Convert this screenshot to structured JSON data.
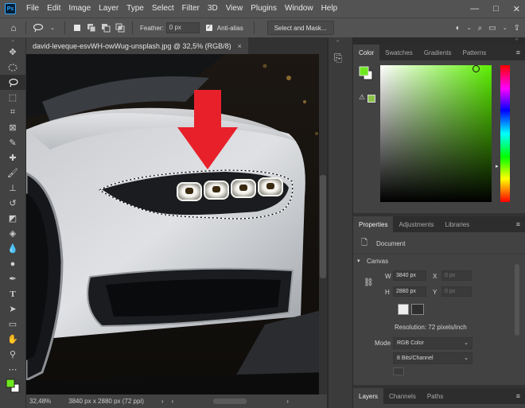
{
  "app": {
    "logo": "Ps"
  },
  "menu": [
    "File",
    "Edit",
    "Image",
    "Layer",
    "Type",
    "Select",
    "Filter",
    "3D",
    "View",
    "Plugins",
    "Window",
    "Help"
  ],
  "window_controls": [
    "—",
    "□",
    "✕"
  ],
  "options": {
    "feather_label": "Feather:",
    "feather_value": "0 px",
    "antialias_label": "Anti-alias",
    "select_mask_label": "Select and Mask..."
  },
  "document": {
    "tab_title": "david-leveque-esvWH-owWug-unsplash.jpg @ 32,5% (RGB/8)",
    "close": "×",
    "zoom": "32,48%",
    "info": "3840 px x 2880 px (72 ppi)"
  },
  "color_panel": {
    "tabs": [
      "Color",
      "Swatches",
      "Gradients",
      "Patterns"
    ],
    "foreground": "#6ee81e",
    "warning_icon": "⚠"
  },
  "properties_panel": {
    "tabs": [
      "Properties",
      "Adjustments",
      "Libraries"
    ],
    "layer_type": "Document",
    "section": "Canvas",
    "w_label": "W",
    "w_value": "3840 px",
    "h_label": "H",
    "h_value": "2880 px",
    "x_label": "X",
    "x_value": "0 px",
    "y_label": "Y",
    "y_value": "0 px",
    "resolution": "Resolution: 72 pixels/inch",
    "mode_label": "Mode",
    "mode_value": "RGB Color",
    "bits_value": "8 Bits/Channel"
  },
  "layers_panel": {
    "tabs": [
      "Layers",
      "Channels",
      "Paths"
    ]
  },
  "colors": {
    "accent_arrow": "#e8202a",
    "panel": "#424242",
    "menubar": "#535353"
  }
}
